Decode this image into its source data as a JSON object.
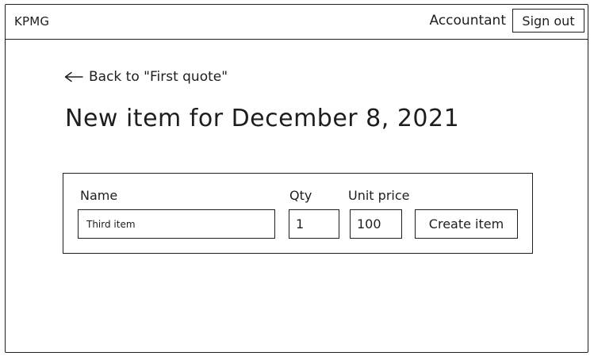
{
  "header": {
    "brand": "KPMG",
    "role": "Accountant",
    "sign_out_label": "Sign out"
  },
  "nav": {
    "back_label": "Back to \"First quote\""
  },
  "page": {
    "title": "New item for December 8, 2021"
  },
  "form": {
    "name_label": "Name",
    "name_value": "Third item",
    "qty_label": "Qty",
    "qty_value": "1",
    "price_label": "Unit price",
    "price_value": "100",
    "submit_label": "Create item"
  },
  "icons": {
    "back": "arrow-left-icon"
  }
}
